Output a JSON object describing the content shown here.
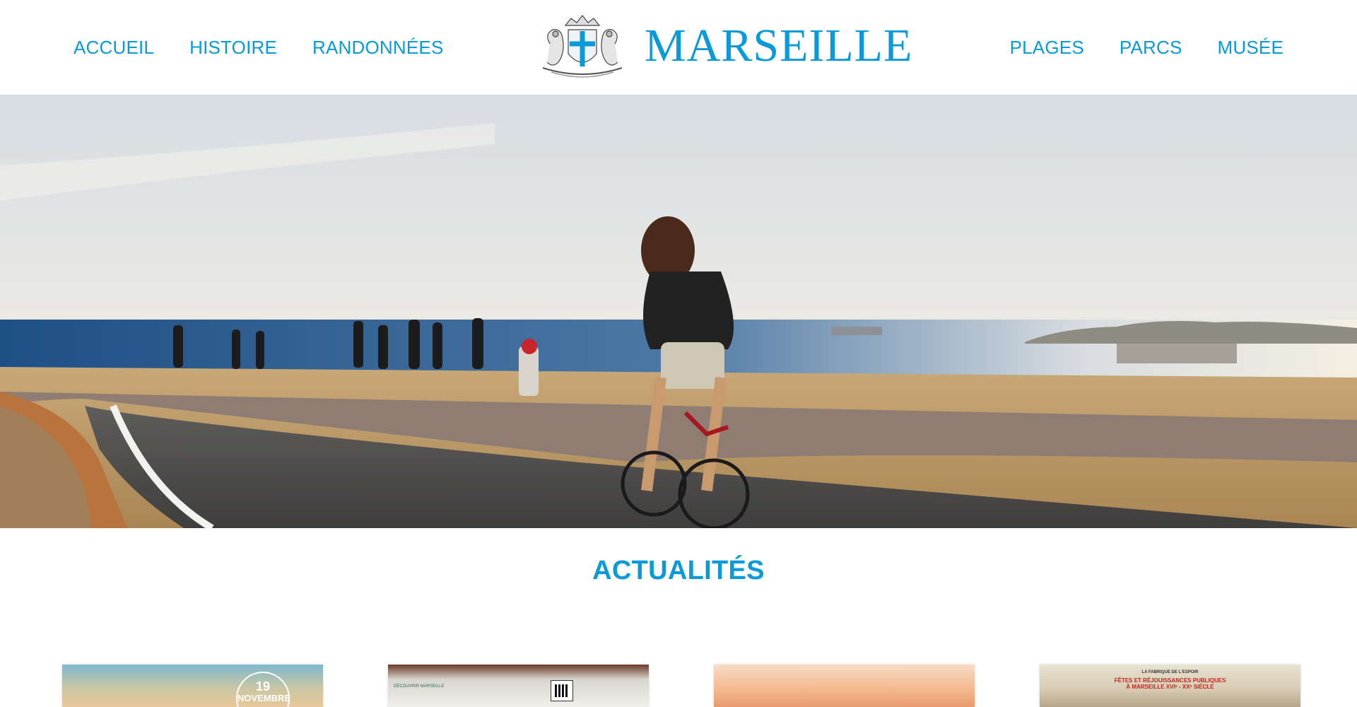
{
  "header": {
    "brand": "MARSEILLE",
    "nav_left": [
      {
        "label": "ACCUEIL"
      },
      {
        "label": "HISTOIRE"
      },
      {
        "label": "RANDONNÉES"
      }
    ],
    "nav_right": [
      {
        "label": "PLAGES"
      },
      {
        "label": "PARCS"
      },
      {
        "label": "MUSÉE"
      }
    ],
    "crest_icon": "city-coat-of-arms-icon"
  },
  "hero": {
    "image": "cyclist-on-seaside-promenade"
  },
  "news": {
    "title": "ACTUALITÉS",
    "cards": [
      {
        "badge_day": "19",
        "badge_month": "NOVEMBRE"
      },
      {
        "tag": "DÉCOUVRIR MARSEILLE"
      },
      {},
      {
        "line1": "LA FABRIQUE DE L'ESPOIR",
        "line2": "FÊTES ET RÉJOUISSANCES PUBLIQUES",
        "line3": "À MARSEILLE XVIᵉ - XXᵉ SIÈCLE"
      }
    ]
  },
  "colors": {
    "accent": "#0a9ad8",
    "background": "#ffffff"
  }
}
